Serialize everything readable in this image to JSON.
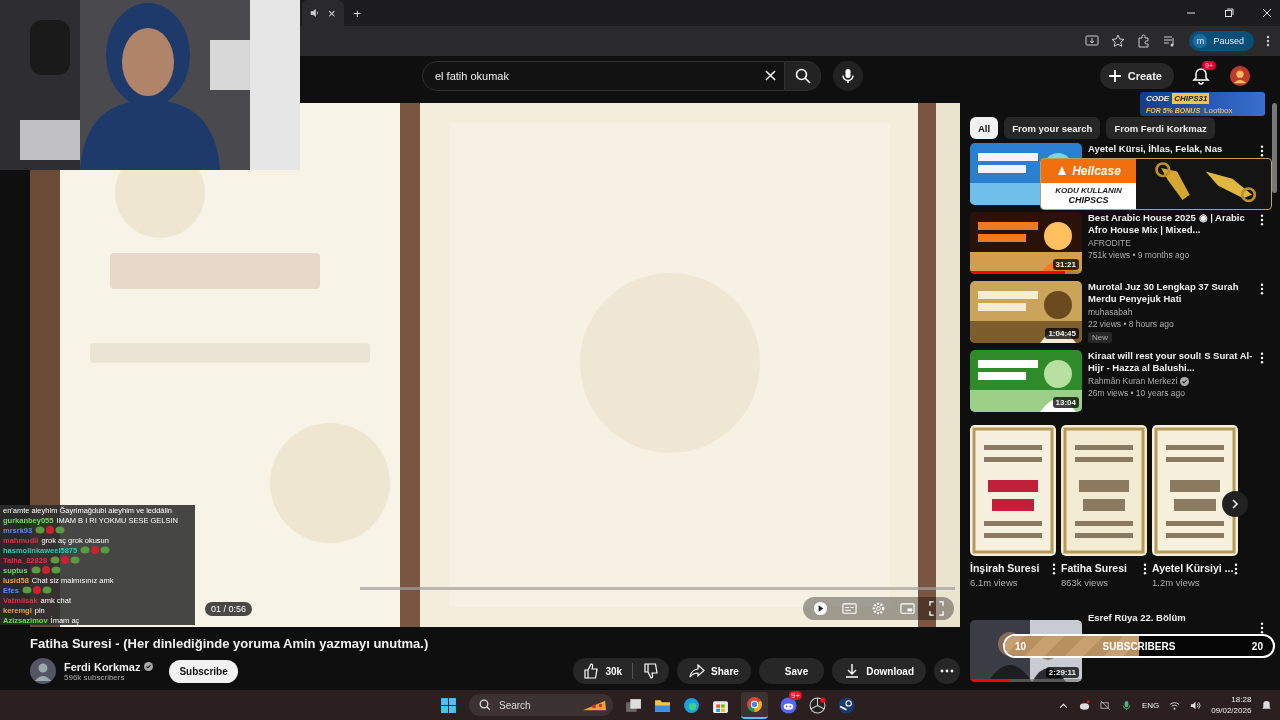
{
  "browser": {
    "tab_close": "×",
    "new_tab": "+",
    "profile_initial": "m",
    "profile_status": "Paused"
  },
  "header": {
    "search_value": "el fatih okumak",
    "create": "Create",
    "notifications": "9+"
  },
  "video": {
    "time": "01 / 0:56"
  },
  "title": "Fatiha Suresi - (Her dinlediğinde yoruma Amin yazmayı unutma.)",
  "channel": {
    "name": "Ferdi Korkmaz",
    "verified": true,
    "subscribers": "596k subscribers",
    "subscribe": "Subscribe"
  },
  "actions": {
    "likes": "30k",
    "share": "Share",
    "save": "Save",
    "download": "Download"
  },
  "chips": [
    {
      "label": "All",
      "selected": true
    },
    {
      "label": "From your search",
      "selected": false
    },
    {
      "label": "From Ferdi Korkmaz",
      "selected": false
    }
  ],
  "related": [
    {
      "title": "Ayetel Kürsi, İhlas, Felak, Nas"
    },
    {
      "title": "Best Arabic House 2025 ◉ | Arabic Afro House Mix | Mixed...",
      "channel": "AFRODITE",
      "meta": "751k views • 9 months ago",
      "duration": "31:21",
      "level": 0.85
    },
    {
      "title": "Murotal Juz 30 Lengkap 37 Surah Merdu Penyejuk Hati",
      "channel": "muhasabah",
      "meta": "22 views • 8 hours ago",
      "badge": "New",
      "duration": "1:04:45"
    },
    {
      "title": "Kiraat will rest your soul! S Surat Al-Hijr - Hazza al Balushi...",
      "channel": "Rahmân Kuran Merkezi",
      "verified": true,
      "meta": "26m views • 10 years ago",
      "duration": "13:04"
    }
  ],
  "shorts": [
    {
      "title": "İnşirah Suresi",
      "views": "6.1m views"
    },
    {
      "title": "Fatiha Suresi",
      "views": "863k views"
    },
    {
      "title": "Ayetel Kürsiyi ...",
      "views": "1.2m views"
    }
  ],
  "last_video": {
    "title": "Esref Rüya 22. Bölüm",
    "duration": "2:29:11",
    "level": 0.35
  },
  "ads": {
    "code_label": "CODE",
    "code": "CHIPS31",
    "bonus": "FOR 5% BONUS",
    "brand": "Lootbox",
    "case_brand": "Hellcase",
    "case_line": "KODU KULLANIN",
    "case_code": "CHIPSCS"
  },
  "sub_goal": {
    "start": "10",
    "label": "SUBSCRIBERS",
    "end": "20",
    "level": 0.5
  },
  "chat": [
    {
      "kind": "continuation",
      "message": "en'amte aleyhim Ğayrimağdubi aleyhim ve leddâlin"
    },
    {
      "kind": "text",
      "user": "gurkanbey055",
      "color": "#6fdc5a",
      "message": "IMAM B I RI YOKMU SESE GELSIN"
    },
    {
      "kind": "emotes",
      "user": "mrsrk93",
      "color": "#5c8cf0"
    },
    {
      "kind": "text",
      "user": "mahmudli",
      "color": "#e0304a",
      "message": "grok aç grok okusun"
    },
    {
      "kind": "emotes",
      "user": "hasmolinkaweel5875",
      "color": "#2ec9b0"
    },
    {
      "kind": "emotes",
      "user": "Talha_82828",
      "color": "#e0304a"
    },
    {
      "kind": "emotes",
      "user": "suptus",
      "color": "#6fdc5a"
    },
    {
      "kind": "text",
      "user": "lusid58",
      "color": "#f0a030",
      "message": "Chat siz malmısınız amk"
    },
    {
      "kind": "emotes",
      "user": "Efes",
      "color": "#5c8cf0"
    },
    {
      "kind": "text",
      "user": "Vatmilsak",
      "color": "#e0304a",
      "message": "amk chat"
    },
    {
      "kind": "text",
      "user": "keremgl",
      "color": "#f0a030",
      "message": "pin"
    },
    {
      "kind": "text",
      "user": "Azizsazimov",
      "color": "#6fdc5a",
      "message": "İmam aç"
    }
  ],
  "taskbar": {
    "search": "Search",
    "language": "ENG",
    "time": "18:28",
    "date": "09/02/2026",
    "discord_badge": "9+"
  }
}
